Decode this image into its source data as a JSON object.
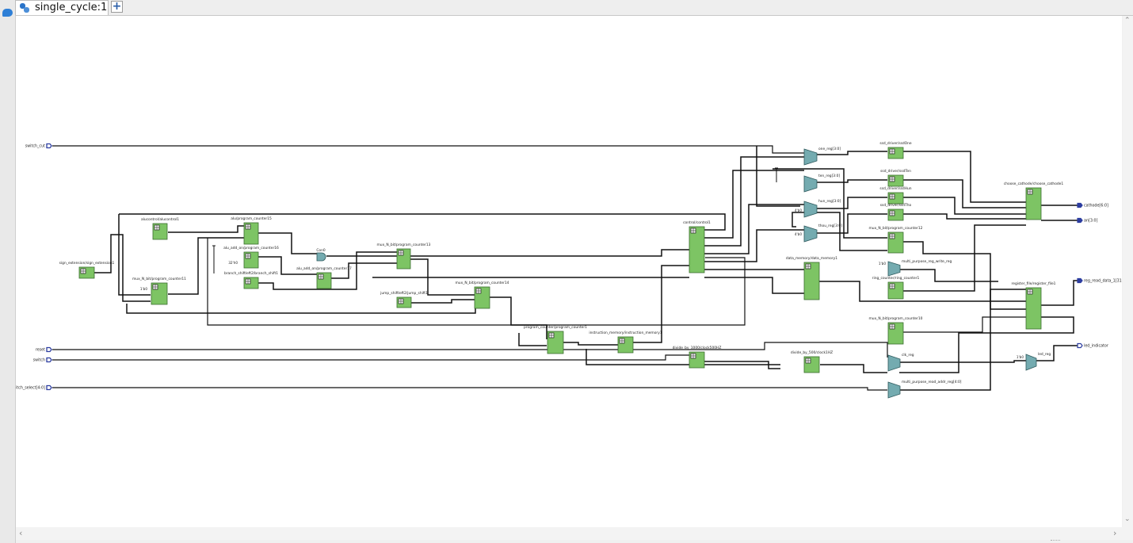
{
  "tab": {
    "title": "single_cycle:1",
    "add_label": "+"
  },
  "ports_in": [
    {
      "id": "switch_cut",
      "label": "switch_cut"
    },
    {
      "id": "reset",
      "label": "reset"
    },
    {
      "id": "switch",
      "label": "switch"
    },
    {
      "id": "switch_select",
      "label": "switch_select[4:0]"
    }
  ],
  "ports_out": [
    {
      "id": "cathode",
      "label": "cathode[6:0]"
    },
    {
      "id": "an",
      "label": "an[3:0]"
    },
    {
      "id": "reg_read_data",
      "label": "reg_read_data_1[31:0]"
    },
    {
      "id": "led",
      "label": "led_indicator"
    }
  ],
  "blocks": [
    {
      "id": "sign_extension",
      "label": "sign_extension/sign_extension1"
    },
    {
      "id": "alucontrol",
      "label": "alucontrol/alucontrol1"
    },
    {
      "id": "alu_pc15",
      "label": "alu/program_counter15"
    },
    {
      "id": "alu_add_pc16",
      "label": "alu_add_on/program_counter16"
    },
    {
      "id": "mux_pc11",
      "label": "mux_N_bit/program_counter11"
    },
    {
      "id": "branch_shift",
      "label": "branch_shiftleft2/branch_shift1"
    },
    {
      "id": "alu_add_pc17",
      "label": "alu_add_on/program_counter17"
    },
    {
      "id": "mux_pc13",
      "label": "mux_N_bit/program_counter13"
    },
    {
      "id": "jump_shift",
      "label": "jump_shiftleft2/jump_shift1"
    },
    {
      "id": "mux_pc14",
      "label": "mux_N_bit/program_counter14"
    },
    {
      "id": "program_counter",
      "label": "program_counter/program_counter1"
    },
    {
      "id": "instruction_memory",
      "label": "instruction_memory/instruction_memory1"
    },
    {
      "id": "divide_1000",
      "label": "divide_by_1000/clock500HZ"
    },
    {
      "id": "control",
      "label": "control/control1"
    },
    {
      "id": "data_memory",
      "label": "data_memory/data_memory1"
    },
    {
      "id": "divide_500",
      "label": "divide_by_500/clock1HZ"
    },
    {
      "id": "ssd_one",
      "label": "ssd_driver/ssdOne"
    },
    {
      "id": "ssd_ten",
      "label": "ssd_driver/ssdTen"
    },
    {
      "id": "ssd_hun",
      "label": "ssd_driver/ssdHun"
    },
    {
      "id": "ssd_tho",
      "label": "ssd_driver/ssdTho"
    },
    {
      "id": "mux_pc12",
      "label": "mux_N_bit/program_counter12"
    },
    {
      "id": "ring_counter",
      "label": "ring_counter/ring_counter1"
    },
    {
      "id": "mux_pc10",
      "label": "mux_N_bit/program_counter10"
    },
    {
      "id": "choose_cathode",
      "label": "choose_cathode/choose_cathode1"
    },
    {
      "id": "register_file",
      "label": "register_file/register_file1"
    }
  ],
  "muxes": [
    {
      "id": "one_reg",
      "label": "one_reg[3:0]"
    },
    {
      "id": "ten_reg",
      "label": "ten_reg[3:0]"
    },
    {
      "id": "hun_reg",
      "label": "hun_reg[3:0]"
    },
    {
      "id": "thou_reg",
      "label": "thou_reg[3:0]"
    },
    {
      "id": "gp_write",
      "label": "multi_purpose_reg_write_reg"
    },
    {
      "id": "clk_reg",
      "label": "clk_reg"
    },
    {
      "id": "led_reg",
      "label": "led_reg"
    },
    {
      "id": "gp_addr",
      "label": "multi_purpose_read_addr_reg[4:0]"
    }
  ],
  "gates": [
    {
      "id": "and_gate",
      "label": "Con0"
    }
  ],
  "consts": [
    {
      "id": "c_32h",
      "label": "32'h0"
    },
    {
      "id": "c_1",
      "label": "1'b0"
    },
    {
      "id": "c_2",
      "label": "1'b0"
    },
    {
      "id": "c_3",
      "label": "4'b0"
    },
    {
      "id": "c_4",
      "label": "4'b0"
    },
    {
      "id": "c_5",
      "label": "1'b0"
    }
  ],
  "colors": {
    "block_fill": "#7dc464",
    "block_stroke": "#3b6d2f",
    "mux_fill": "#74abb0",
    "port_in": "#2c3da0",
    "wire": "#111111"
  }
}
